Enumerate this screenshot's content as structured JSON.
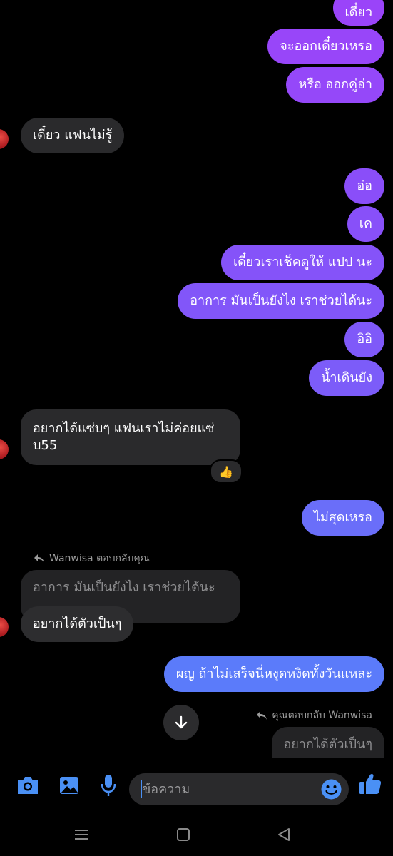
{
  "messages": {
    "m0": "เดี๋ยว",
    "m1": "จะออกเดี๋ยวเหรอ",
    "m2": "หรือ ออกคู่อ่า",
    "m3": "เดี๋ยว แฟนไม่รู้",
    "m4": "อ่อ",
    "m5": "เค",
    "m6": "เดี๋ยวเราเช็คดูให้ แปป นะ",
    "m7": "อาการ มันเป็นยังไง เราช่วยได้นะ",
    "m8": "อิอิ",
    "m9": "น้ำเดินยัง",
    "m10_line1": "อยากได้แซ่บๆ แฟนเราไม่ค่อยแซ่",
    "m10_line2": "บ55",
    "m10_reaction": "👍",
    "m11": "ไม่สุดเหรอ",
    "reply1_meta": "Wanwisa ตอบกลับคุณ",
    "reply1_quote": "อาการ มันเป็นยังไง เราช่วยได้นะ",
    "m12": "อยากได้ตัวเป็นๆ",
    "m13": "ผญ ถ้าไม่เสร็จนี่หงุดหงิดทั้งวันแหละ",
    "reply2_meta": "คุณตอบกลับ Wanwisa",
    "reply2_quote": "อยากได้ตัวเป็นๆ"
  },
  "composer": {
    "placeholder": "ข้อความ"
  },
  "icons": {
    "camera": "camera-icon",
    "gallery": "image-icon",
    "mic": "microphone-icon",
    "emoji": "emoji-icon",
    "like": "thumbs-up-icon",
    "scroll_down": "arrow-down-icon",
    "reply": "reply-icon",
    "nav_menu": "recent-apps-icon",
    "nav_home": "home-icon",
    "nav_back": "back-icon"
  },
  "colors": {
    "outgoing_top": "#8f47f7",
    "outgoing_bottom": "#5b7bfa",
    "incoming": "#2a2a2c",
    "accent": "#4a90f5",
    "background": "#000000"
  }
}
